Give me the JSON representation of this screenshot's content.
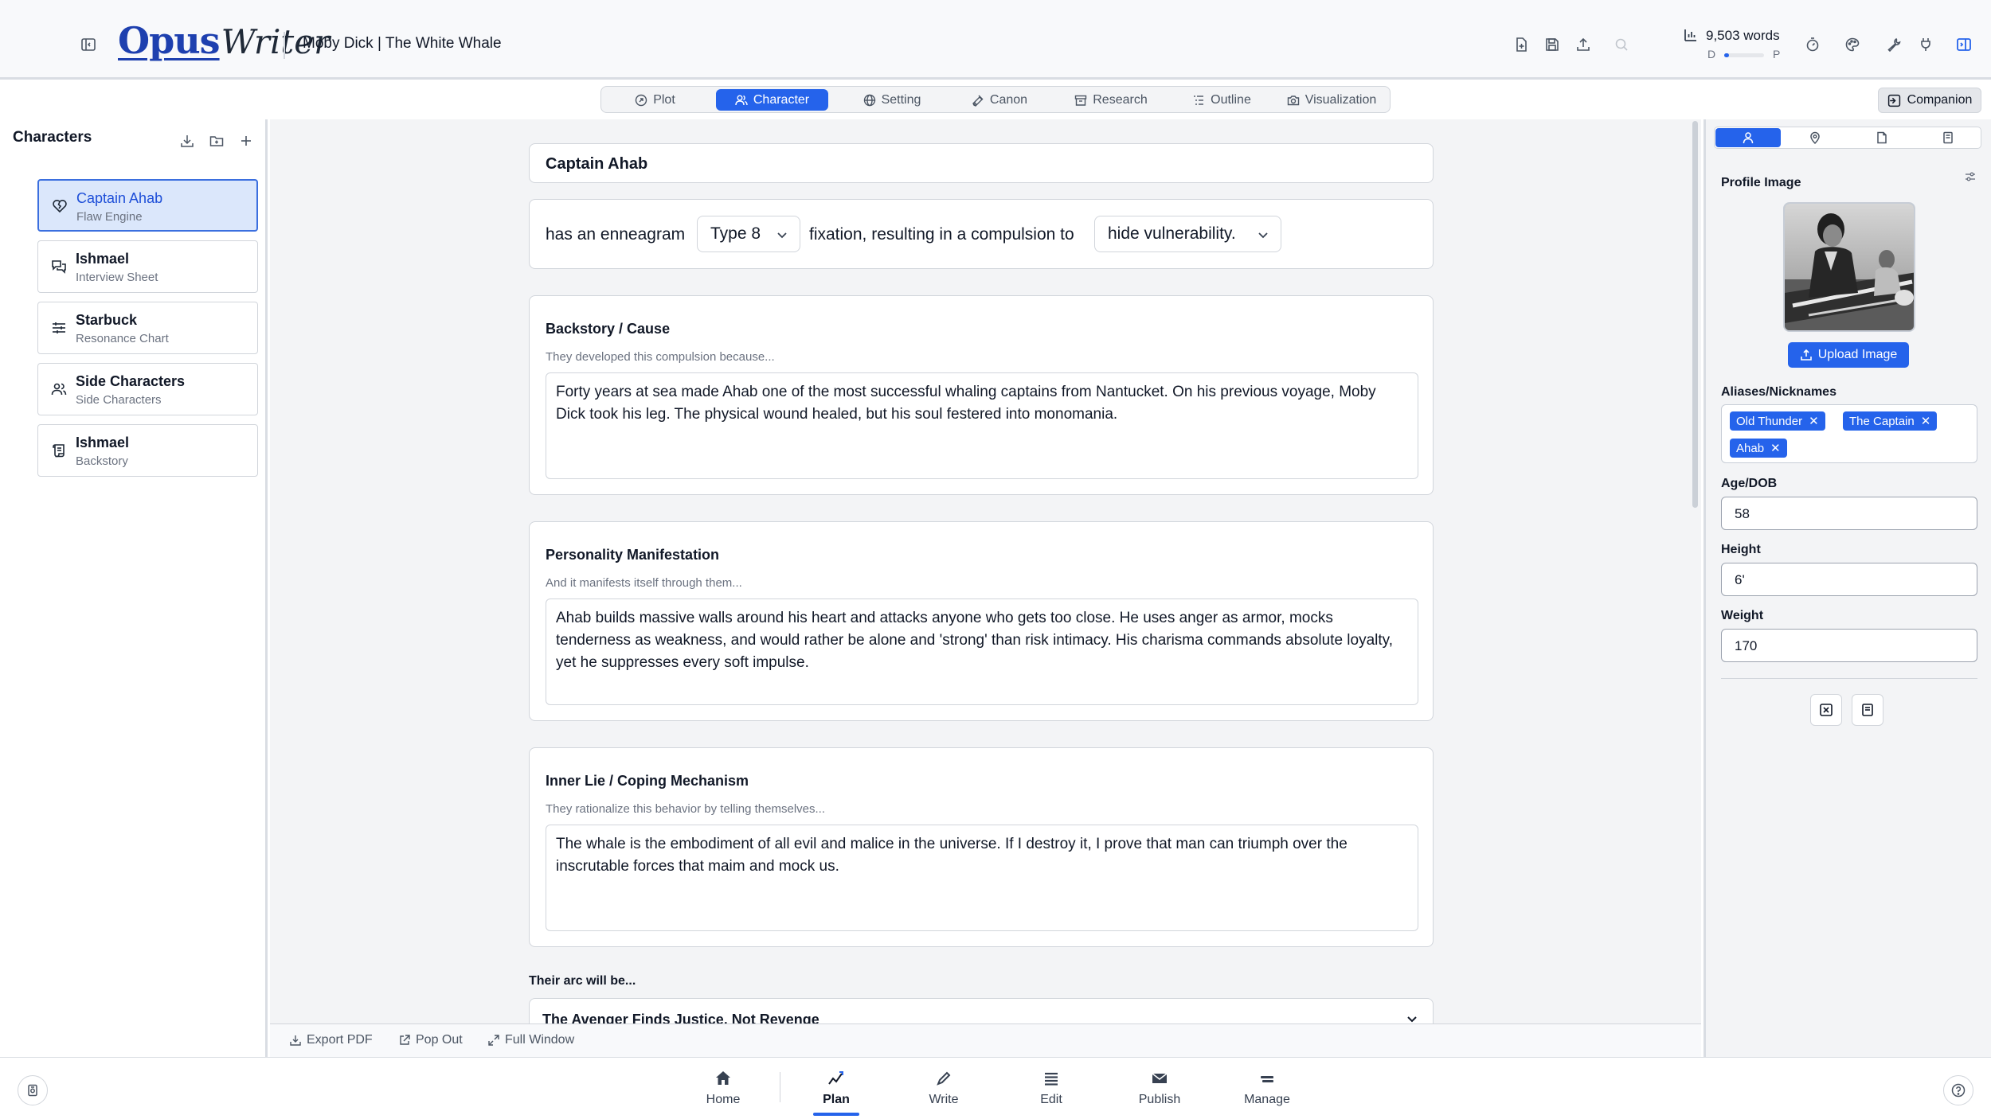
{
  "app": {
    "logo_part1": "Opus",
    "logo_part2": "Writer",
    "project_title": "Moby Dick | The White Whale"
  },
  "wordcount": {
    "label": "9,503 words",
    "left_marker": "D",
    "right_marker": "P",
    "progress": 0.12
  },
  "tabs": [
    {
      "label": "Plot",
      "icon": "plot-icon"
    },
    {
      "label": "Character",
      "icon": "character-icon",
      "active": true
    },
    {
      "label": "Setting",
      "icon": "globe-icon"
    },
    {
      "label": "Canon",
      "icon": "canon-icon"
    },
    {
      "label": "Research",
      "icon": "archive-icon"
    },
    {
      "label": "Outline",
      "icon": "list-icon"
    },
    {
      "label": "Visualization",
      "icon": "camera-icon"
    }
  ],
  "companion": {
    "label": "Companion"
  },
  "sidebar": {
    "title": "Characters",
    "items": [
      {
        "name": "Captain Ahab",
        "subtitle": "Flaw Engine",
        "icon": "heart-crack-icon",
        "active": true
      },
      {
        "name": "Ishmael",
        "subtitle": "Interview Sheet",
        "icon": "chat-icon"
      },
      {
        "name": "Starbuck",
        "subtitle": "Resonance Chart",
        "icon": "sliders-icon"
      },
      {
        "name": "Side Characters",
        "subtitle": "Side Characters",
        "icon": "users-icon"
      },
      {
        "name": "Ishmael",
        "subtitle": "Backstory",
        "icon": "scroll-icon"
      }
    ]
  },
  "main": {
    "character_name": "Captain Ahab",
    "enneagram": {
      "prefix": "has an enneagram",
      "type_value": "Type 8",
      "middle": "fixation, resulting in a compulsion to",
      "compulsion_value": "hide vulnerability."
    },
    "sections": [
      {
        "title": "Backstory / Cause",
        "hint": "They developed this compulsion because...",
        "text": "Forty years at sea made Ahab one of the most successful whaling captains from Nantucket. On his previous voyage, Moby Dick took his leg. The physical wound healed, but his soul festered into monomania."
      },
      {
        "title": "Personality Manifestation",
        "hint": "And it manifests itself through them...",
        "text": "Ahab builds massive walls around his heart and attacks anyone who gets too close. He uses anger as armor, mocks tenderness as weakness, and would rather be alone and 'strong' than risk intimacy. His charisma commands absolute loyalty, yet he suppresses every soft impulse."
      },
      {
        "title": "Inner Lie / Coping Mechanism",
        "hint": "They rationalize this behavior by telling themselves...",
        "text": "The whale is the embodiment of all evil and malice in the universe. If I destroy it, I prove that man can triumph over the inscrutable forces that maim and mock us."
      }
    ],
    "arc_label": "Their arc will be...",
    "arc_value": "The Avenger Finds Justice, Not Revenge"
  },
  "footer": {
    "export_pdf": "Export PDF",
    "pop_out": "Pop Out",
    "full_window": "Full Window"
  },
  "profile": {
    "profile_image_label": "Profile Image",
    "upload_label": "Upload Image",
    "aliases_label": "Aliases/Nicknames",
    "aliases": [
      "Old Thunder",
      "The Captain",
      "Ahab"
    ],
    "age_label": "Age/DOB",
    "age_value": "58",
    "height_label": "Height",
    "height_value": "6'",
    "weight_label": "Weight",
    "weight_value": "170"
  },
  "bottom_nav": [
    {
      "label": "Home",
      "icon": "home-icon"
    },
    {
      "label": "Plan",
      "icon": "plan-icon",
      "active": true
    },
    {
      "label": "Write",
      "icon": "pen-icon"
    },
    {
      "label": "Edit",
      "icon": "menu-icon"
    },
    {
      "label": "Publish",
      "icon": "mail-icon"
    },
    {
      "label": "Manage",
      "icon": "manage-icon"
    }
  ],
  "colors": {
    "accent": "#2563eb",
    "active_bg": "#dbe7fb",
    "panel_bg": "#f3f4f6"
  }
}
